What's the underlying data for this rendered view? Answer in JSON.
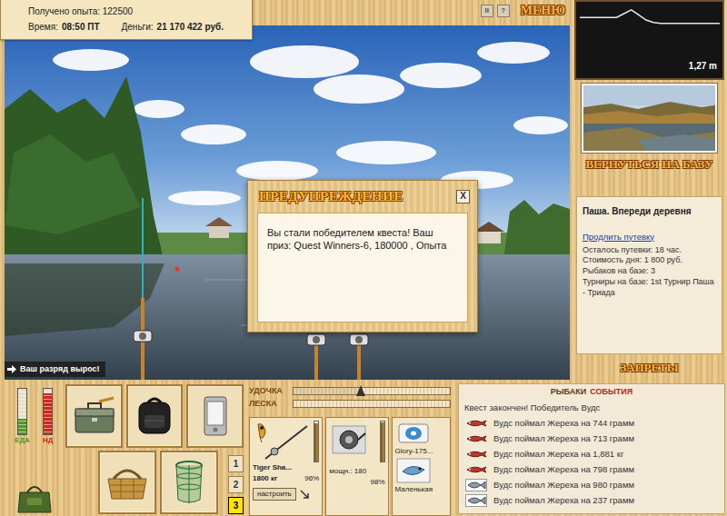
{
  "stats": {
    "experience": "Получено опыта: 122500",
    "time_label": "Время:",
    "time": "08:50 ПТ",
    "money_label": "Деньги:",
    "money": "21 170 422 руб."
  },
  "toolbar": [
    {
      "label": "II",
      "kind": "icon"
    },
    {
      "label": "?",
      "kind": "icon"
    },
    {
      "label": "МЕНЮ",
      "kind": "text"
    }
  ],
  "depth": {
    "profile": [
      0.8,
      0.8,
      0.8,
      0.8,
      0.8,
      0.8,
      0.5,
      0.2,
      0.6,
      1.0,
      1.2,
      1.27,
      1.27,
      1.27,
      1.27,
      1.27,
      1.27,
      1.27,
      1.27,
      1.27
    ],
    "reading": "1,27 m"
  },
  "dialog": {
    "title": "ПРЕДУПРЕЖДЕНИЕ",
    "close": "X",
    "message": "Вы стали победителем квеста! Ваш приз: Quest Winners-6, 180000 , Опыта"
  },
  "notice": {
    "text": "Ваш разряд вырос!"
  },
  "base": {
    "return": "ВЕРНУТЬСЯ НА БАЗУ",
    "place": "Паша. Впереди деревня",
    "extend": "Продлить путевку",
    "lines": [
      "Осталось путевки: 18 час.",
      "Стоимость дня: 1 800 руб.",
      "Рыбаков на базе: 3",
      "Турниры на базе: 1st Турнир Паша - Триада"
    ],
    "bans": "ЗАПРЕТЫ"
  },
  "needs": [
    {
      "label": "ЕДА",
      "level": 0.35,
      "color": "#4f9a24"
    },
    {
      "label": "НД",
      "level": 0.9,
      "color": "#d0281a"
    }
  ],
  "slots": [
    {
      "label": "1",
      "selected": false
    },
    {
      "label": "2",
      "selected": false
    },
    {
      "label": "3",
      "selected": true
    }
  ],
  "tension": [
    {
      "label": "УДОЧКА",
      "level": 0.43
    },
    {
      "label": "ЛЕСКА",
      "level": 0
    }
  ],
  "tackle": {
    "rod": {
      "name": "Tiger Sha...",
      "load": "1800 кг",
      "wear": "96%",
      "level": 0.96,
      "button": "настроить"
    },
    "reel": {
      "power": "мощн.: 180",
      "wear": "98%",
      "level": 0.98
    },
    "line": "Glory-175...",
    "lure": "Маленькая"
  },
  "events": {
    "tabs": [
      {
        "label": "РЫБАКИ",
        "selected": false
      },
      {
        "label": "СОБЫТИЯ",
        "selected": true
      }
    ],
    "items": [
      {
        "text": "Квест закончен! Победитель Вудс",
        "kind": "info"
      },
      {
        "text": "Вудс поймал Жереха на 744 грамм",
        "kind": "small"
      },
      {
        "text": "Вудс поймал Жереха на 713 грамм",
        "kind": "small"
      },
      {
        "text": "Вудс поймал Жереха на 1,881 кг",
        "kind": "small"
      },
      {
        "text": "Вудс поймал Жереха на 798 грамм",
        "kind": "small"
      },
      {
        "text": "Вудс поймал Жереха на 980 грамм",
        "kind": "boxed"
      },
      {
        "text": "Вудс поймал Жереха на 237 грамм",
        "kind": "boxed"
      }
    ]
  }
}
